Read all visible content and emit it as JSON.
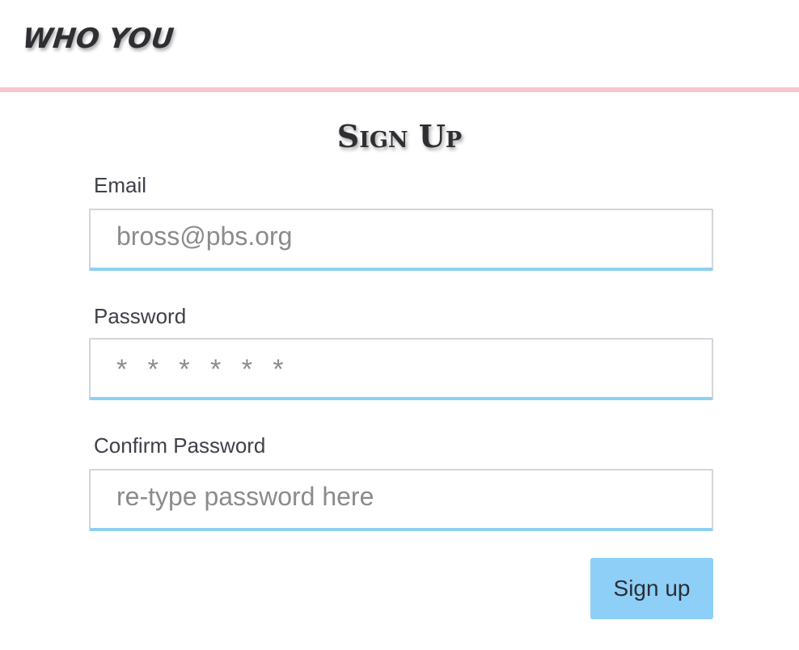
{
  "header": {
    "brand": "WHO YOU",
    "divider_color": "#f7c6cf"
  },
  "form": {
    "title": "Sign Up",
    "email": {
      "label": "Email",
      "placeholder": "bross@pbs.org"
    },
    "password": {
      "label": "Password",
      "placeholder": "* * * * * *"
    },
    "confirm_password": {
      "label": "Confirm Password",
      "placeholder": "re-type password here"
    },
    "submit_label": "Sign up",
    "accent_color": "#8ecff7"
  }
}
